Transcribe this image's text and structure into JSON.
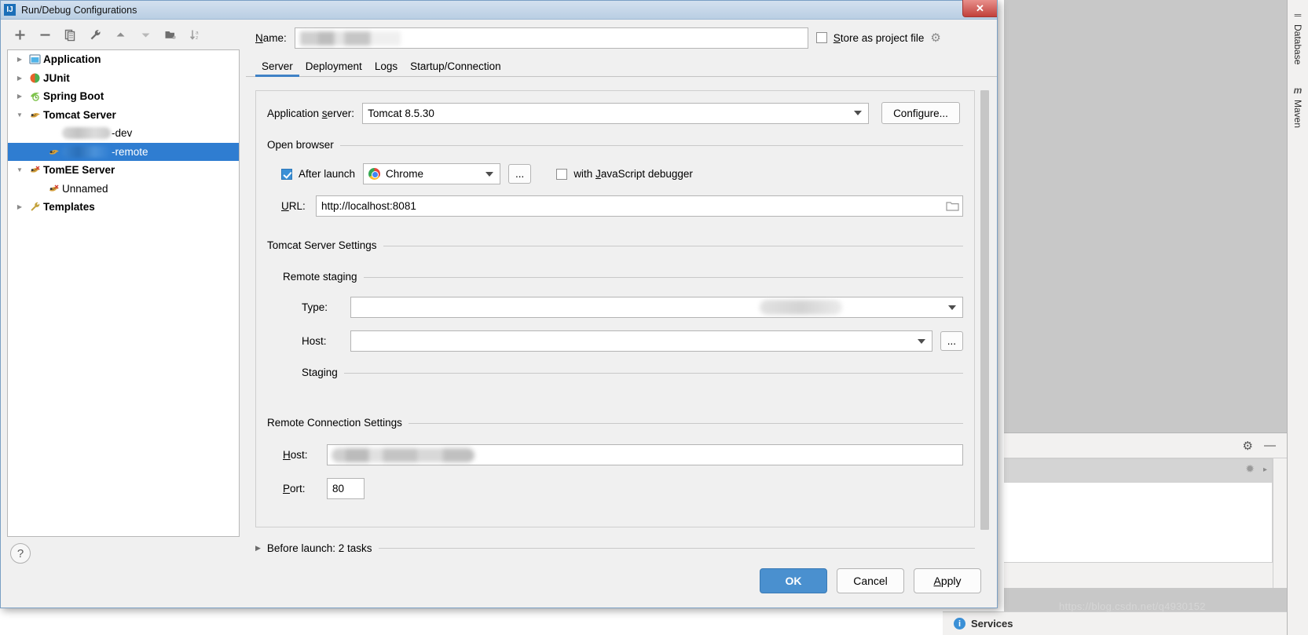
{
  "window": {
    "title": "Run/Debug Configurations",
    "title_icon": "intellij-idea-icon",
    "close_label": "✕"
  },
  "toolbar": {
    "buttons": [
      {
        "name": "add-configuration-button",
        "icon": "plus-icon",
        "tooltip": "Add New Configuration"
      },
      {
        "name": "remove-configuration-button",
        "icon": "minus-icon",
        "tooltip": "Remove Configuration"
      },
      {
        "name": "copy-configuration-button",
        "icon": "copy-icon",
        "tooltip": "Copy Configuration"
      },
      {
        "name": "edit-templates-button",
        "icon": "wrench-icon",
        "tooltip": "Edit Templates"
      },
      {
        "name": "move-up-button",
        "icon": "arrow-up-icon",
        "tooltip": "Move Up"
      },
      {
        "name": "move-down-button",
        "icon": "arrow-down-icon",
        "tooltip": "Move Down"
      },
      {
        "name": "new-folder-button",
        "icon": "folder-add-icon",
        "tooltip": "Create New Folder"
      },
      {
        "name": "sort-button",
        "icon": "sort-az-icon",
        "tooltip": "Sort Configurations"
      }
    ]
  },
  "tree": {
    "items": [
      {
        "label": "Application",
        "icon": "application-icon",
        "expandable": true,
        "expanded": false,
        "indent": 0,
        "bold": true,
        "selected": false,
        "redacted": false
      },
      {
        "label": "JUnit",
        "icon": "junit-icon",
        "expandable": true,
        "expanded": false,
        "indent": 0,
        "bold": true,
        "selected": false,
        "redacted": false
      },
      {
        "label": "Spring Boot",
        "icon": "spring-boot-icon",
        "expandable": true,
        "expanded": false,
        "indent": 0,
        "bold": true,
        "selected": false,
        "redacted": false
      },
      {
        "label": "Tomcat Server",
        "icon": "tomcat-icon",
        "expandable": true,
        "expanded": true,
        "indent": 0,
        "bold": true,
        "selected": false,
        "redacted": false
      },
      {
        "label": "-dev",
        "icon": "none",
        "expandable": false,
        "expanded": false,
        "indent": 1,
        "bold": false,
        "selected": false,
        "redacted": true,
        "redacted_width": 62
      },
      {
        "label": "-remote",
        "icon": "tomcat-icon",
        "expandable": false,
        "expanded": false,
        "indent": 1,
        "bold": false,
        "selected": true,
        "redacted": true,
        "redacted_width": 62
      },
      {
        "label": "TomEE Server",
        "icon": "tomee-icon",
        "expandable": true,
        "expanded": true,
        "indent": 0,
        "bold": true,
        "selected": false,
        "redacted": false
      },
      {
        "label": "Unnamed",
        "icon": "tomee-icon",
        "expandable": false,
        "expanded": false,
        "indent": 1,
        "bold": false,
        "selected": false,
        "redacted": false
      },
      {
        "label": "Templates",
        "icon": "wrench-icon",
        "expandable": true,
        "expanded": false,
        "indent": 0,
        "bold": true,
        "selected": false,
        "redacted": false
      }
    ]
  },
  "help": {
    "label": "?"
  },
  "name_row": {
    "label": "Name:",
    "value": "",
    "value_redacted": true,
    "store_as_project_file_label": "Store as project file",
    "store_as_project_file_checked": false,
    "gear_icon": "gear-dropdown-icon"
  },
  "tabs": {
    "items": [
      "Server",
      "Deployment",
      "Logs",
      "Startup/Connection"
    ],
    "active_index": 0
  },
  "server_tab": {
    "application_server": {
      "label": "Application server:",
      "value": "Tomcat 8.5.30",
      "configure_button": "Configure..."
    },
    "open_browser": {
      "title": "Open browser",
      "after_launch_label": "After launch",
      "after_launch_checked": true,
      "browser": "Chrome",
      "browser_icon": "chrome-icon",
      "ellipsis_button": "...",
      "js_debugger_label": "with JavaScript debugger",
      "js_debugger_checked": false,
      "url_label": "URL:",
      "url_value": "http://localhost:8081",
      "url_browse_icon": "folder-browse-icon"
    },
    "tomcat_server_settings": {
      "title": "Tomcat Server Settings",
      "remote_staging": {
        "title": "Remote staging",
        "type_label": "Type:",
        "type_value": "",
        "type_redacted": true,
        "host_label": "Host:",
        "host_value": "",
        "host_ellipsis_button": "...",
        "staging_title": "Staging"
      }
    },
    "remote_connection_settings": {
      "title": "Remote Connection Settings",
      "host_label": "Host:",
      "host_value": "",
      "host_redacted": true,
      "port_label": "Port:",
      "port_value": "80"
    }
  },
  "before_launch": {
    "label": "Before launch: 2 tasks",
    "expanded": false
  },
  "footer": {
    "ok": "OK",
    "cancel": "Cancel",
    "apply": "Apply",
    "ok_color": "#4a90cf"
  },
  "ide": {
    "right_tool_windows": [
      {
        "label": "Database",
        "icon": "database-icon"
      },
      {
        "label": "Maven",
        "icon": "maven-m-icon"
      }
    ],
    "bottom_panel": {
      "settings_icon": "gear-icon",
      "minimize_icon": "minimize-icon",
      "loading_icon": "spinner-icon"
    },
    "status_bar": {
      "services_label": "Services",
      "services_icon": "info-icon"
    },
    "watermark": "https://blog.csdn.net/q4930152"
  }
}
